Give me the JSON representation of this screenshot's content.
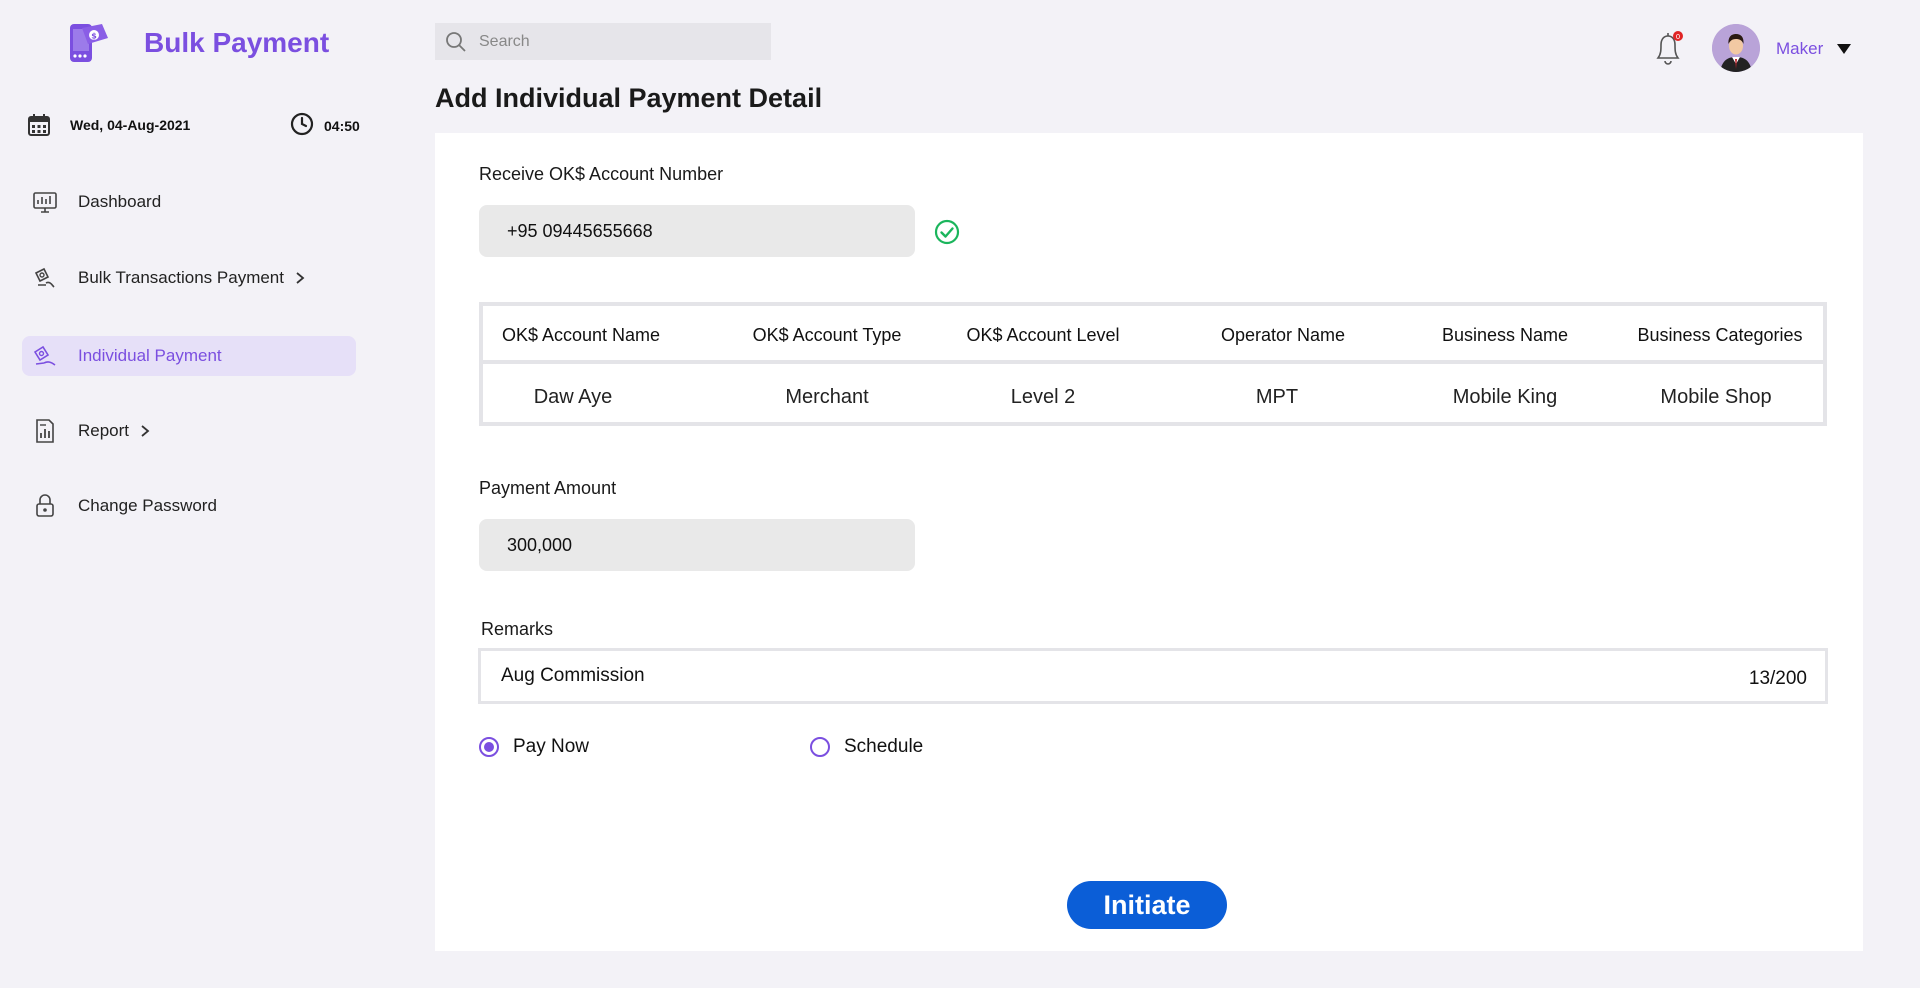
{
  "brand": {
    "title": "Bulk Payment"
  },
  "datetime": {
    "date": "Wed, 04-Aug-2021",
    "time": "04:50"
  },
  "sidebar": {
    "items": [
      {
        "label": "Dashboard",
        "icon": "dashboard-icon",
        "has_chevron": false,
        "active": false
      },
      {
        "label": "Bulk Transactions Payment",
        "icon": "bulk-transfer-icon",
        "has_chevron": true,
        "active": false
      },
      {
        "label": "Individual Payment",
        "icon": "individual-payment-icon",
        "has_chevron": false,
        "active": true
      },
      {
        "label": "Report",
        "icon": "report-icon",
        "has_chevron": true,
        "active": false
      },
      {
        "label": "Change Password",
        "icon": "lock-icon",
        "has_chevron": false,
        "active": false
      }
    ]
  },
  "search": {
    "placeholder": "Search"
  },
  "header": {
    "notification_count": "0",
    "user_name": "Maker"
  },
  "page": {
    "title": "Add Individual Payment Detail"
  },
  "form": {
    "account_label": "Receive OK$ Account Number",
    "account_value": "+95 09445655668",
    "table": {
      "headers": [
        "OK$ Account Name",
        "OK$ Account Type",
        "OK$ Account Level",
        "Operator Name",
        "Business Name",
        "Business Categories"
      ],
      "row": [
        "Daw Aye",
        "Merchant",
        "Level 2",
        "MPT",
        "Mobile King",
        "Mobile Shop"
      ]
    },
    "amount_label": "Payment Amount",
    "amount_value": "300,000",
    "remarks_label": "Remarks",
    "remarks_value": "Aug Commission",
    "remarks_count": "13/200",
    "options": [
      {
        "label": "Pay Now",
        "selected": true
      },
      {
        "label": "Schedule",
        "selected": false
      }
    ],
    "submit_label": "Initiate"
  },
  "colors": {
    "accent": "#7b4fe0",
    "primary_button": "#0b5ed7",
    "success": "#1bb55c",
    "background": "#f3f2f7"
  }
}
